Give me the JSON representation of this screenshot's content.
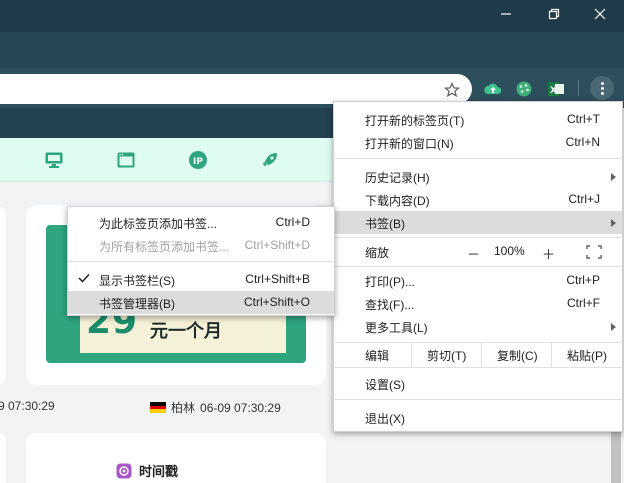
{
  "window": {
    "controls": [
      "minimize",
      "maximize",
      "close"
    ],
    "colors": {
      "titlebar": "#1f3a48",
      "toolbar": "#2d4e5b",
      "accent": "#2ea57f"
    }
  },
  "toolbar": {
    "icons": [
      "bookmark-star-icon",
      "cloud-upload-extension-icon",
      "palette-extension-icon",
      "excel-extension-icon",
      "more-menu-icon"
    ]
  },
  "page": {
    "promo": {
      "big_number": "29",
      "slogan": "元一个月"
    },
    "time_left": "9 07:30:29",
    "time_right": {
      "city": "柏林",
      "datetime": "06-09 07:30:29"
    },
    "section_title": "时间戳"
  },
  "menu": {
    "items": [
      {
        "label": "打开新的标签页(T)",
        "shortcut": "Ctrl+T"
      },
      {
        "label": "打开新的窗口(N)",
        "shortcut": "Ctrl+N"
      },
      {
        "label": "历史记录(H)",
        "shortcut": "",
        "submenu": true
      },
      {
        "label": "下载内容(D)",
        "shortcut": "Ctrl+J"
      },
      {
        "label": "书签(B)",
        "shortcut": "",
        "submenu": true,
        "highlighted": true
      },
      {
        "label": "打印(P)...",
        "shortcut": "Ctrl+P"
      },
      {
        "label": "查找(F)...",
        "shortcut": "Ctrl+F"
      },
      {
        "label": "更多工具(L)",
        "shortcut": "",
        "submenu": true
      },
      {
        "label": "设置(S)",
        "shortcut": ""
      },
      {
        "label": "退出(X)",
        "shortcut": ""
      }
    ],
    "zoom": {
      "label": "缩放",
      "minus": "－",
      "value": "100%",
      "plus": "＋"
    },
    "edit": {
      "label": "编辑",
      "cut": "剪切(T)",
      "copy": "复制(C)",
      "paste": "粘贴(P)"
    }
  },
  "bookmarks_submenu": {
    "items": [
      {
        "label": "为此标签页添加书签...",
        "shortcut": "Ctrl+D",
        "enabled": true
      },
      {
        "label": "为所有标签页添加书签...",
        "shortcut": "Ctrl+Shift+D",
        "enabled": false
      },
      {
        "label": "显示书签栏(S)",
        "shortcut": "Ctrl+Shift+B",
        "checked": true
      },
      {
        "label": "书签管理器(B)",
        "shortcut": "Ctrl+Shift+O",
        "highlighted": true
      }
    ]
  }
}
